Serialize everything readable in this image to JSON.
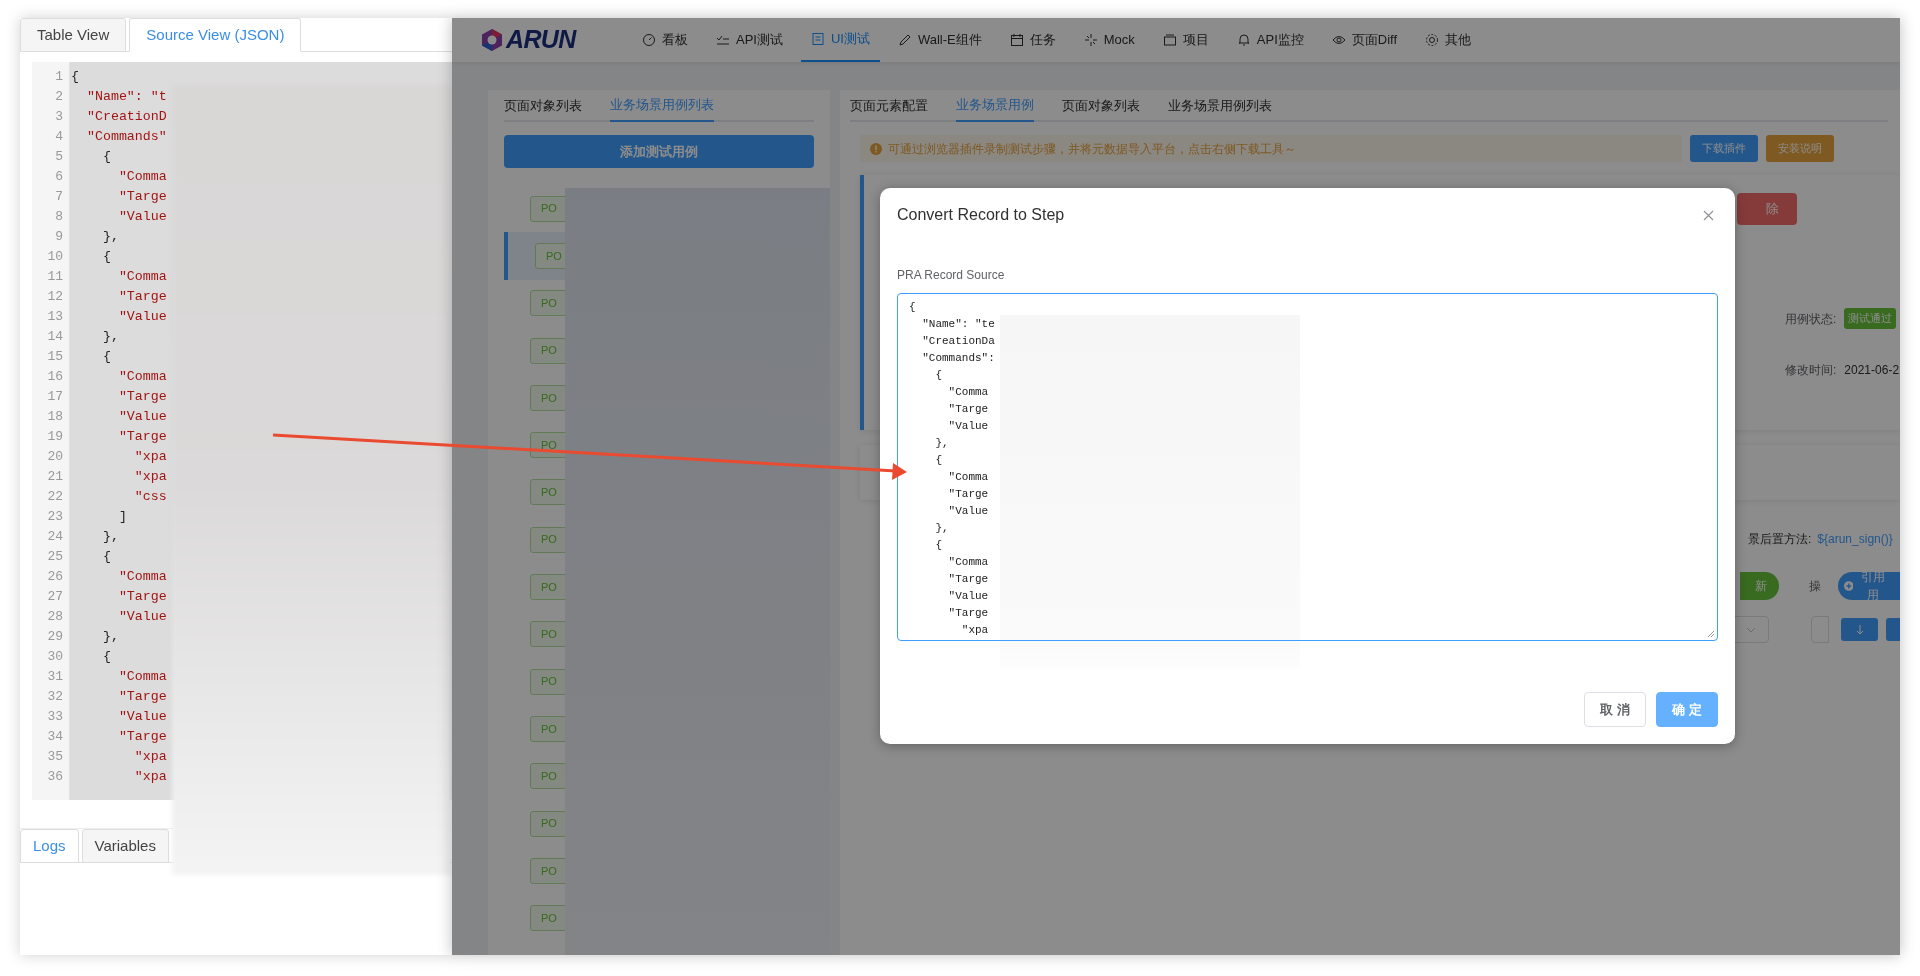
{
  "left_window": {
    "tabs": [
      {
        "label": "Table View",
        "selected": false
      },
      {
        "label": "Source View (JSON)",
        "selected": true
      }
    ],
    "code_lines": [
      {
        "number": "1",
        "text": "{",
        "kind": "punct"
      },
      {
        "number": "2",
        "text": "  \"Name\": \"t",
        "kind": "key"
      },
      {
        "number": "3",
        "text": "  \"CreationD",
        "kind": "key"
      },
      {
        "number": "4",
        "text": "  \"Commands\"",
        "kind": "key"
      },
      {
        "number": "5",
        "text": "    {",
        "kind": "punct"
      },
      {
        "number": "6",
        "text": "      \"Comma",
        "kind": "key"
      },
      {
        "number": "7",
        "text": "      \"Targe",
        "kind": "key"
      },
      {
        "number": "8",
        "text": "      \"Value",
        "kind": "key"
      },
      {
        "number": "9",
        "text": "    },",
        "kind": "punct"
      },
      {
        "number": "10",
        "text": "    {",
        "kind": "punct"
      },
      {
        "number": "11",
        "text": "      \"Comma",
        "kind": "key"
      },
      {
        "number": "12",
        "text": "      \"Targe",
        "kind": "key"
      },
      {
        "number": "13",
        "text": "      \"Value",
        "kind": "key"
      },
      {
        "number": "14",
        "text": "    },",
        "kind": "punct"
      },
      {
        "number": "15",
        "text": "    {",
        "kind": "punct"
      },
      {
        "number": "16",
        "text": "      \"Comma",
        "kind": "key"
      },
      {
        "number": "17",
        "text": "      \"Targe",
        "kind": "key"
      },
      {
        "number": "18",
        "text": "      \"Value",
        "kind": "key"
      },
      {
        "number": "19",
        "text": "      \"Targe",
        "kind": "key"
      },
      {
        "number": "20",
        "text": "        \"xpa",
        "kind": "key"
      },
      {
        "number": "21",
        "text": "        \"xpa",
        "kind": "key"
      },
      {
        "number": "22",
        "text": "        \"css",
        "kind": "key"
      },
      {
        "number": "23",
        "text": "      ]",
        "kind": "punct"
      },
      {
        "number": "24",
        "text": "    },",
        "kind": "punct"
      },
      {
        "number": "25",
        "text": "    {",
        "kind": "punct"
      },
      {
        "number": "26",
        "text": "      \"Comma",
        "kind": "key"
      },
      {
        "number": "27",
        "text": "      \"Targe",
        "kind": "key"
      },
      {
        "number": "28",
        "text": "      \"Value",
        "kind": "key"
      },
      {
        "number": "29",
        "text": "    },",
        "kind": "punct"
      },
      {
        "number": "30",
        "text": "    {",
        "kind": "punct"
      },
      {
        "number": "31",
        "text": "      \"Comma",
        "kind": "key"
      },
      {
        "number": "32",
        "text": "      \"Targe",
        "kind": "key"
      },
      {
        "number": "33",
        "text": "      \"Value",
        "kind": "key"
      },
      {
        "number": "34",
        "text": "      \"Targe",
        "kind": "key"
      },
      {
        "number": "35",
        "text": "        \"xpa",
        "kind": "key"
      },
      {
        "number": "36",
        "text": "        \"xpa",
        "kind": "key"
      }
    ],
    "bottom_tabs": [
      {
        "label": "Logs",
        "selected": true
      },
      {
        "label": "Variables",
        "selected": false
      }
    ]
  },
  "app": {
    "logo": "ARUN",
    "nav": [
      {
        "label": "看板",
        "selected": false
      },
      {
        "label": "API测试",
        "selected": false
      },
      {
        "label": "UI测试",
        "selected": true
      },
      {
        "label": "Wall-E组件",
        "selected": false
      },
      {
        "label": "任务",
        "selected": false
      },
      {
        "label": "Mock",
        "selected": false
      },
      {
        "label": "项目",
        "selected": false
      },
      {
        "label": "API监控",
        "selected": false
      },
      {
        "label": "页面Diff",
        "selected": false
      },
      {
        "label": "其他",
        "selected": false
      }
    ],
    "left_panel": {
      "tabs": [
        {
          "label": "页面对象列表",
          "selected": false
        },
        {
          "label": "业务场景用例列表",
          "selected": true
        }
      ],
      "add_button": "添加测试用例",
      "cases": [
        {
          "tag": "PO",
          "selected": false
        },
        {
          "tag": "PO",
          "selected": true
        },
        {
          "tag": "PO",
          "selected": false
        },
        {
          "tag": "PO",
          "selected": false
        },
        {
          "tag": "PO",
          "selected": false
        },
        {
          "tag": "PO",
          "selected": false
        },
        {
          "tag": "PO",
          "selected": false
        },
        {
          "tag": "PO",
          "selected": false
        },
        {
          "tag": "PO",
          "selected": false
        },
        {
          "tag": "PO",
          "selected": false
        },
        {
          "tag": "PO",
          "selected": false
        },
        {
          "tag": "PO",
          "selected": false
        },
        {
          "tag": "PO",
          "selected": false
        },
        {
          "tag": "PO",
          "selected": false
        },
        {
          "tag": "PO",
          "selected": false
        },
        {
          "tag": "PO",
          "selected": false
        }
      ]
    },
    "right_panel": {
      "tabs": [
        {
          "label": "页面元素配置",
          "selected": false
        },
        {
          "label": "业务场景用例",
          "selected": true
        },
        {
          "label": "页面对象列表",
          "selected": false
        },
        {
          "label": "业务场景用例列表",
          "selected": false
        }
      ],
      "notice": "可通过浏览器插件录制测试步骤，并将元数据导入平台，点击右侧下载工具～",
      "buttons": [
        {
          "label": "下载插件",
          "kind": "primary"
        },
        {
          "label": "安装说明",
          "kind": "warning"
        }
      ],
      "delete_button": "除",
      "status_label": "用例状态:",
      "status": "测试通过",
      "modified_label": "修改时间:",
      "modified": "2021-06-2",
      "post_method_label": "景后置方法:",
      "post_method": "${arun_sign()}",
      "refresh_button": "新",
      "actions_label": "操",
      "quote_button": "引用用"
    }
  },
  "modal": {
    "title": "Convert Record to Step",
    "field_label": "PRA Record Source",
    "source_lines": [
      "{",
      "  \"Name\": \"te",
      "  \"CreationDa",
      "  \"Commands\":",
      "    {",
      "      \"Comma",
      "      \"Targe",
      "      \"Value",
      "    },",
      "    {",
      "      \"Comma",
      "      \"Targe",
      "      \"Value",
      "    },",
      "    {",
      "      \"Comma",
      "      \"Targe",
      "      \"Value",
      "      \"Targe",
      "        \"xpa"
    ],
    "buttons": [
      {
        "label": "取 消",
        "kind": "default"
      },
      {
        "label": "确 定",
        "kind": "primary"
      }
    ]
  }
}
